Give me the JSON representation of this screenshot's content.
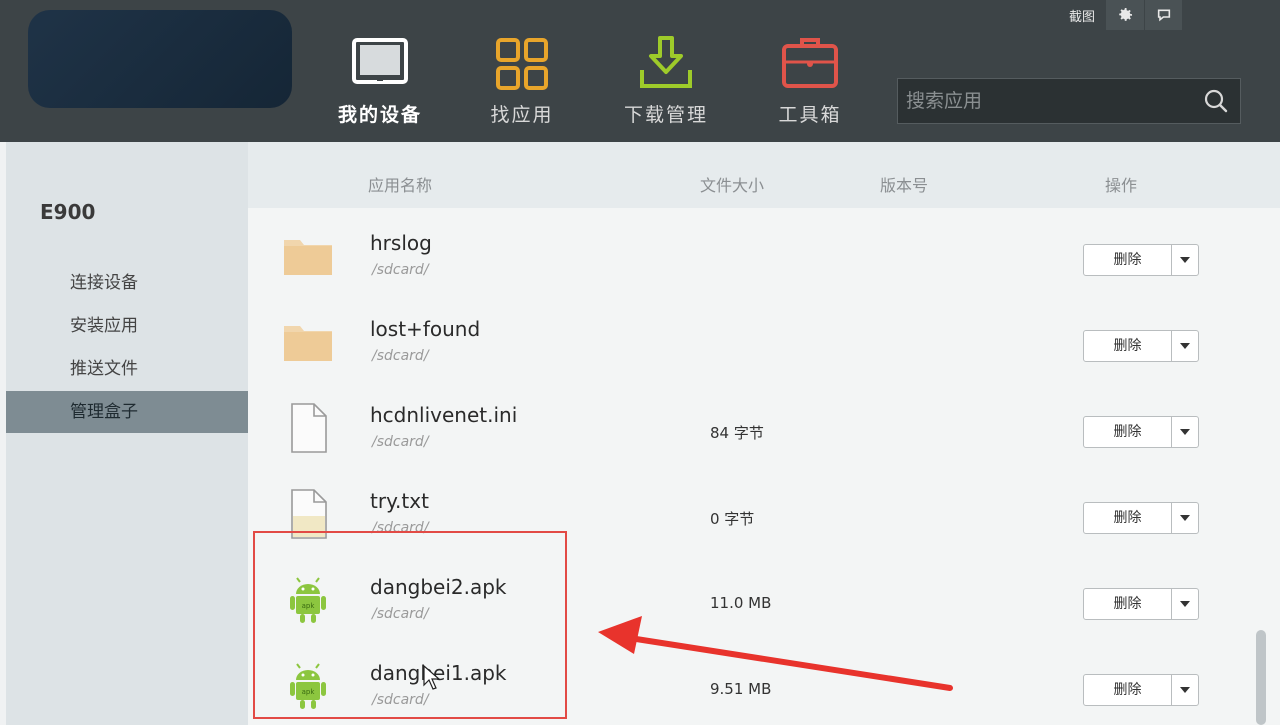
{
  "top_actions": {
    "screenshot": "截图",
    "gear_icon": "gear-icon",
    "message_icon": "speech-bubble-icon"
  },
  "nav": [
    {
      "label": "我的设备",
      "icon": "monitor-icon",
      "color": "#ffffff",
      "active": true
    },
    {
      "label": "找应用",
      "icon": "grid-icon",
      "color": "#e8a52b",
      "active": false
    },
    {
      "label": "下载管理",
      "icon": "download-icon",
      "color": "#9ecb2a",
      "active": false
    },
    {
      "label": "工具箱",
      "icon": "toolbox-icon",
      "color": "#e0544a",
      "active": false
    }
  ],
  "search": {
    "placeholder": "搜索应用",
    "icon": "search-icon"
  },
  "sidebar": {
    "device_name": "E900",
    "items": [
      {
        "label": "连接设备"
      },
      {
        "label": "安装应用"
      },
      {
        "label": "推送文件"
      },
      {
        "label": "管理盒子",
        "active": true
      }
    ]
  },
  "columns": {
    "name": "应用名称",
    "size": "文件大小",
    "version": "版本号",
    "action": "操作"
  },
  "files": [
    {
      "name": "hrslog",
      "path": "/sdcard/",
      "size": "",
      "icon": "folder-icon",
      "action": "删除"
    },
    {
      "name": "lost+found",
      "path": "/sdcard/",
      "size": "",
      "icon": "folder-icon",
      "action": "删除"
    },
    {
      "name": "hcdnlivenet.ini",
      "path": "/sdcard/",
      "size": "84 字节",
      "icon": "file-icon",
      "action": "删除"
    },
    {
      "name": "try.txt",
      "path": "/sdcard/",
      "size": "0 字节",
      "icon": "file-icon",
      "action": "删除"
    },
    {
      "name": "dangbei2.apk",
      "path": "/sdcard/",
      "size": "11.0 MB",
      "icon": "android-apk-icon",
      "action": "删除"
    },
    {
      "name": "dangbei1.apk",
      "path": "/sdcard/",
      "size": "9.51 MB",
      "icon": "android-apk-icon",
      "action": "删除"
    }
  ],
  "colors": {
    "header_bg": "#3d4447",
    "sidebar_active": "#7e8c93",
    "annotation_red": "#e24a45"
  }
}
